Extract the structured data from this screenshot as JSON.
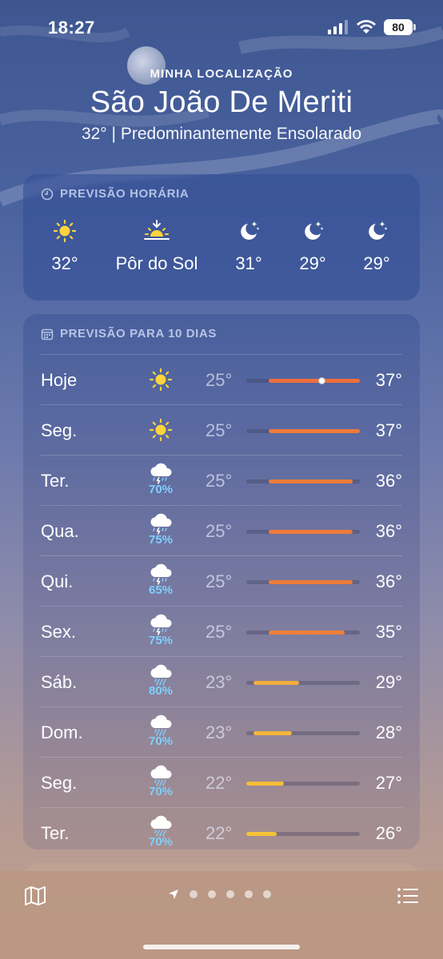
{
  "status_bar": {
    "time": "18:27",
    "battery": "80"
  },
  "header": {
    "location_label": "MINHA LOCALIZAÇÃO",
    "city": "São João De Meriti",
    "summary": "32°  |  Predominantemente Ensolarado"
  },
  "hourly": {
    "title": "PREVISÃO HORÁRIA",
    "items": [
      {
        "icon": "sun-icon",
        "label": "32°"
      },
      {
        "icon": "sunset-icon",
        "label": "Pôr do Sol"
      },
      {
        "icon": "moon-stars-icon",
        "label": "31°"
      },
      {
        "icon": "moon-stars-icon",
        "label": "29°"
      },
      {
        "icon": "moon-stars-icon",
        "label": "29°"
      }
    ]
  },
  "daily": {
    "title": "PREVISÃO PARA 10 DIAS",
    "range_min": 22,
    "range_max": 37,
    "days": [
      {
        "name": "Hoje",
        "icon": "sun-icon",
        "pop": "",
        "low": "25°",
        "high": "37°",
        "low_val": 25,
        "high_val": 37,
        "current_val": 32,
        "color": "#ef6f3c"
      },
      {
        "name": "Seg.",
        "icon": "sun-icon",
        "pop": "",
        "low": "25°",
        "high": "37°",
        "low_val": 25,
        "high_val": 37,
        "color": "#ef7a3a"
      },
      {
        "name": "Ter.",
        "icon": "storm-cloud-icon",
        "pop": "70%",
        "low": "25°",
        "high": "36°",
        "low_val": 25,
        "high_val": 36,
        "color": "#ef7a3a"
      },
      {
        "name": "Qua.",
        "icon": "storm-cloud-icon",
        "pop": "75%",
        "low": "25°",
        "high": "36°",
        "low_val": 25,
        "high_val": 36,
        "color": "#ef7a3a"
      },
      {
        "name": "Qui.",
        "icon": "storm-cloud-icon",
        "pop": "65%",
        "low": "25°",
        "high": "36°",
        "low_val": 25,
        "high_val": 36,
        "color": "#ef7a3a"
      },
      {
        "name": "Sex.",
        "icon": "storm-cloud-icon",
        "pop": "75%",
        "low": "25°",
        "high": "35°",
        "low_val": 25,
        "high_val": 35,
        "color": "#ef7f3a"
      },
      {
        "name": "Sáb.",
        "icon": "rain-cloud-icon",
        "pop": "80%",
        "low": "23°",
        "high": "29°",
        "low_val": 23,
        "high_val": 29,
        "color": "#f2ae3c"
      },
      {
        "name": "Dom.",
        "icon": "rain-cloud-icon",
        "pop": "70%",
        "low": "23°",
        "high": "28°",
        "low_val": 23,
        "high_val": 28,
        "color": "#f4b53a"
      },
      {
        "name": "Seg.",
        "icon": "rain-cloud-icon",
        "pop": "70%",
        "low": "22°",
        "high": "27°",
        "low_val": 22,
        "high_val": 27,
        "color": "#f5bd38"
      },
      {
        "name": "Ter.",
        "icon": "rain-cloud-icon",
        "pop": "70%",
        "low": "22°",
        "high": "26°",
        "low_val": 22,
        "high_val": 26,
        "color": "#f5c238"
      }
    ]
  },
  "bottom_bar": {
    "map_icon": "map-icon",
    "location_icon": "location-arrow-icon",
    "page_count": 5,
    "list_icon": "list-icon"
  }
}
